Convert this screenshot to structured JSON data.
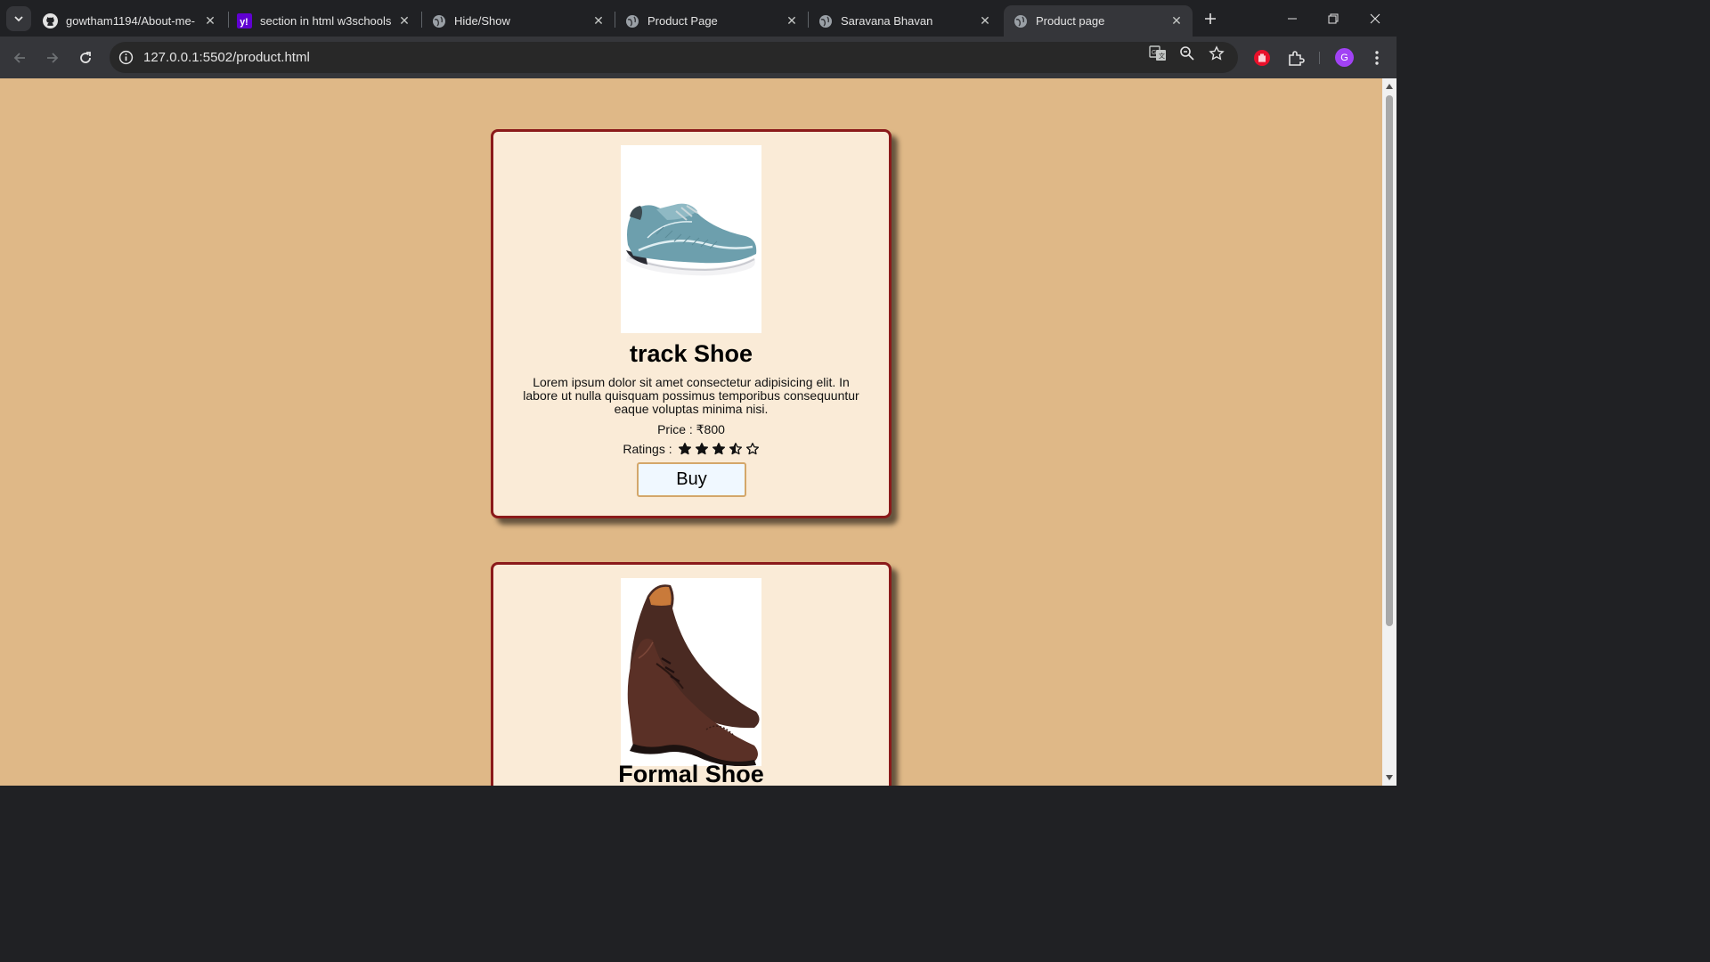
{
  "browser": {
    "tabs": [
      {
        "title": "gowtham1194/About-me-",
        "icon": "github-icon",
        "active": false
      },
      {
        "title": "section in html w3schools",
        "icon": "yahoo-icon",
        "active": false
      },
      {
        "title": "Hide/Show",
        "icon": "globe-icon",
        "active": false
      },
      {
        "title": "Product Page",
        "icon": "globe-icon",
        "active": false
      },
      {
        "title": "Saravana Bhavan",
        "icon": "globe-icon",
        "active": false
      },
      {
        "title": "Product page",
        "icon": "globe-icon",
        "active": true
      }
    ],
    "url": "127.0.0.1:5502/product.html",
    "profile_initial": "G",
    "colors": {
      "page_bg": "#dfb887",
      "card_bg": "#faebd7",
      "card_border": "#8b1a1a",
      "profile": "#a142f4"
    }
  },
  "products": [
    {
      "title": "track Shoe",
      "description": "Lorem ipsum dolor sit amet consectetur adipisicing elit. In labore ut nulla quisquam possimus temporibus consequuntur eaque voluptas minima nisi.",
      "price": "Price : ₹800",
      "ratings_label": "Ratings :",
      "rating": 3.5,
      "rating_max": 5,
      "buy_label": "Buy"
    },
    {
      "title": "Formal Shoe"
    }
  ]
}
